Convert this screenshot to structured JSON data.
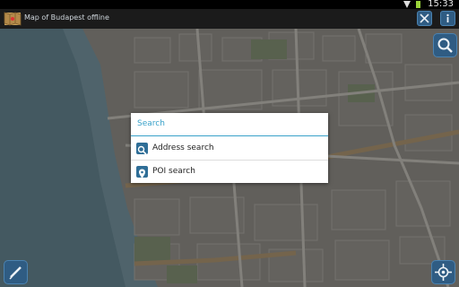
{
  "status_bar": {
    "time": "15:33"
  },
  "app_bar": {
    "title": "Map of Budapest offline"
  },
  "dialog": {
    "title": "Search",
    "items": [
      {
        "label": "Address search",
        "icon": "search-icon"
      },
      {
        "label": "POI search",
        "icon": "map-pin-icon"
      }
    ]
  },
  "colors": {
    "accent": "#39a1c9",
    "app_bar": "#1b1b1b",
    "button_blue": "#2f5c83"
  }
}
